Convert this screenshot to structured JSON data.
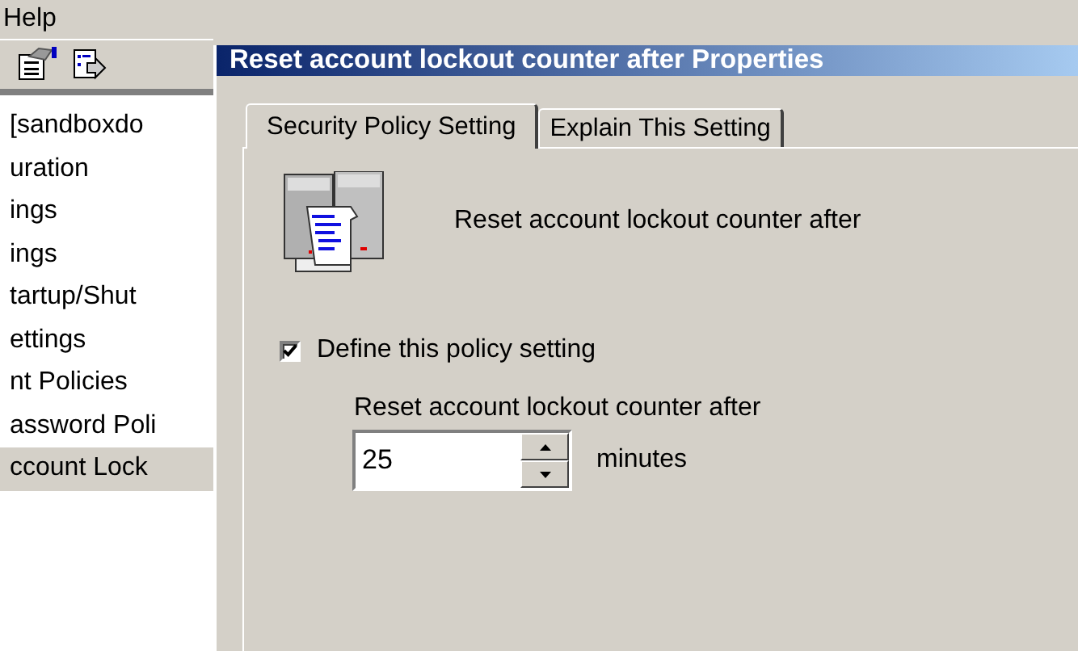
{
  "menu_bar": {
    "items": [
      "Help"
    ]
  },
  "tree": {
    "items": [
      {
        "label": "[sandboxdo",
        "selected": false
      },
      {
        "label": "uration",
        "selected": false
      },
      {
        "label": "ings",
        "selected": false
      },
      {
        "label": "ings",
        "selected": false
      },
      {
        "label": "tartup/Shut",
        "selected": false
      },
      {
        "label": "ettings",
        "selected": false
      },
      {
        "label": "nt Policies",
        "selected": false
      },
      {
        "label": "assword Poli",
        "selected": false
      },
      {
        "label": "ccount Lock",
        "selected": true
      }
    ]
  },
  "dialog": {
    "title": "Reset account lockout counter after Properties",
    "tabs": [
      {
        "label": "Security Policy Setting",
        "selected": true
      },
      {
        "label": "Explain This Setting",
        "selected": false
      }
    ],
    "policy_name": "Reset account lockout counter after",
    "define_checkbox": {
      "label": "Define this policy setting",
      "checked": true
    },
    "value_label": "Reset account lockout counter after",
    "spinner": {
      "value": "25",
      "unit": "minutes"
    }
  }
}
